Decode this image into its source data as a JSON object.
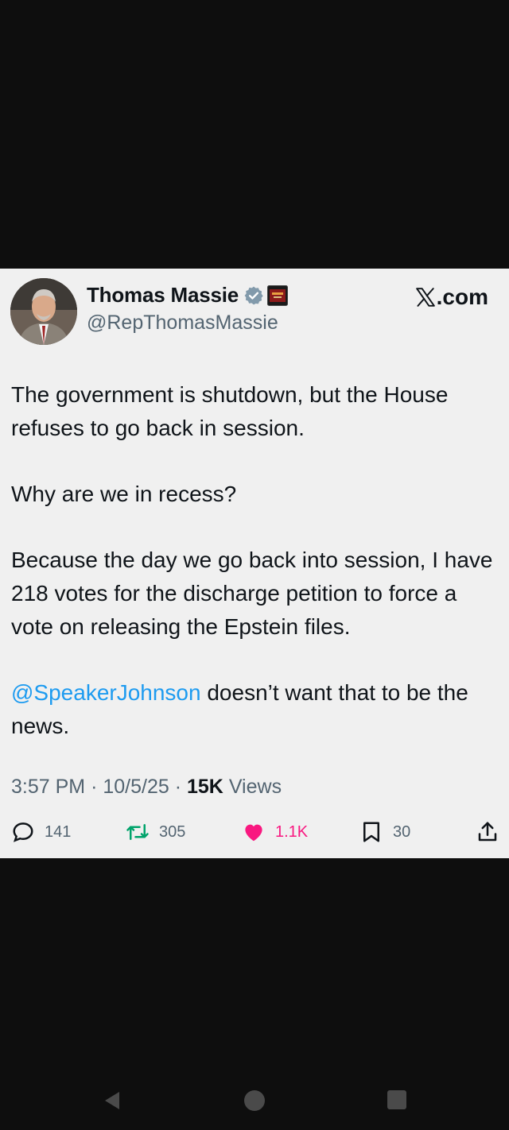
{
  "tweet": {
    "author_name": "Thomas Massie",
    "handle": "@RepThomasMassie",
    "site": ".com",
    "paragraphs": [
      [
        "The government is shutdown, but the House refuses to go back in session."
      ],
      [
        "Why are we in recess?"
      ],
      [
        "Because the day we go back into session, I have 218 votes for the discharge petition to force a vote on releasing the Epstein files."
      ]
    ],
    "last_mention": "@SpeakerJohnson",
    "last_text": " doesn’t want that to be the news.",
    "time": "3:57 PM",
    "date": "10/5/25",
    "views_count": "15K",
    "views_label": "Views",
    "replies": "141",
    "reposts": "305",
    "likes": "1.1K",
    "bookmarks": "30"
  },
  "colors": {
    "background": "#0e0e0e",
    "card": "#f0f0f0",
    "mention": "#1d9bf0",
    "like": "#f91880",
    "secondary_text": "#536471"
  },
  "icons": [
    "verified-badge-icon",
    "affiliation-badge-icon",
    "x-logo-icon",
    "reply-icon",
    "repost-icon",
    "heart-icon",
    "bookmark-icon",
    "share-icon",
    "back-icon",
    "home-icon",
    "recents-icon"
  ]
}
